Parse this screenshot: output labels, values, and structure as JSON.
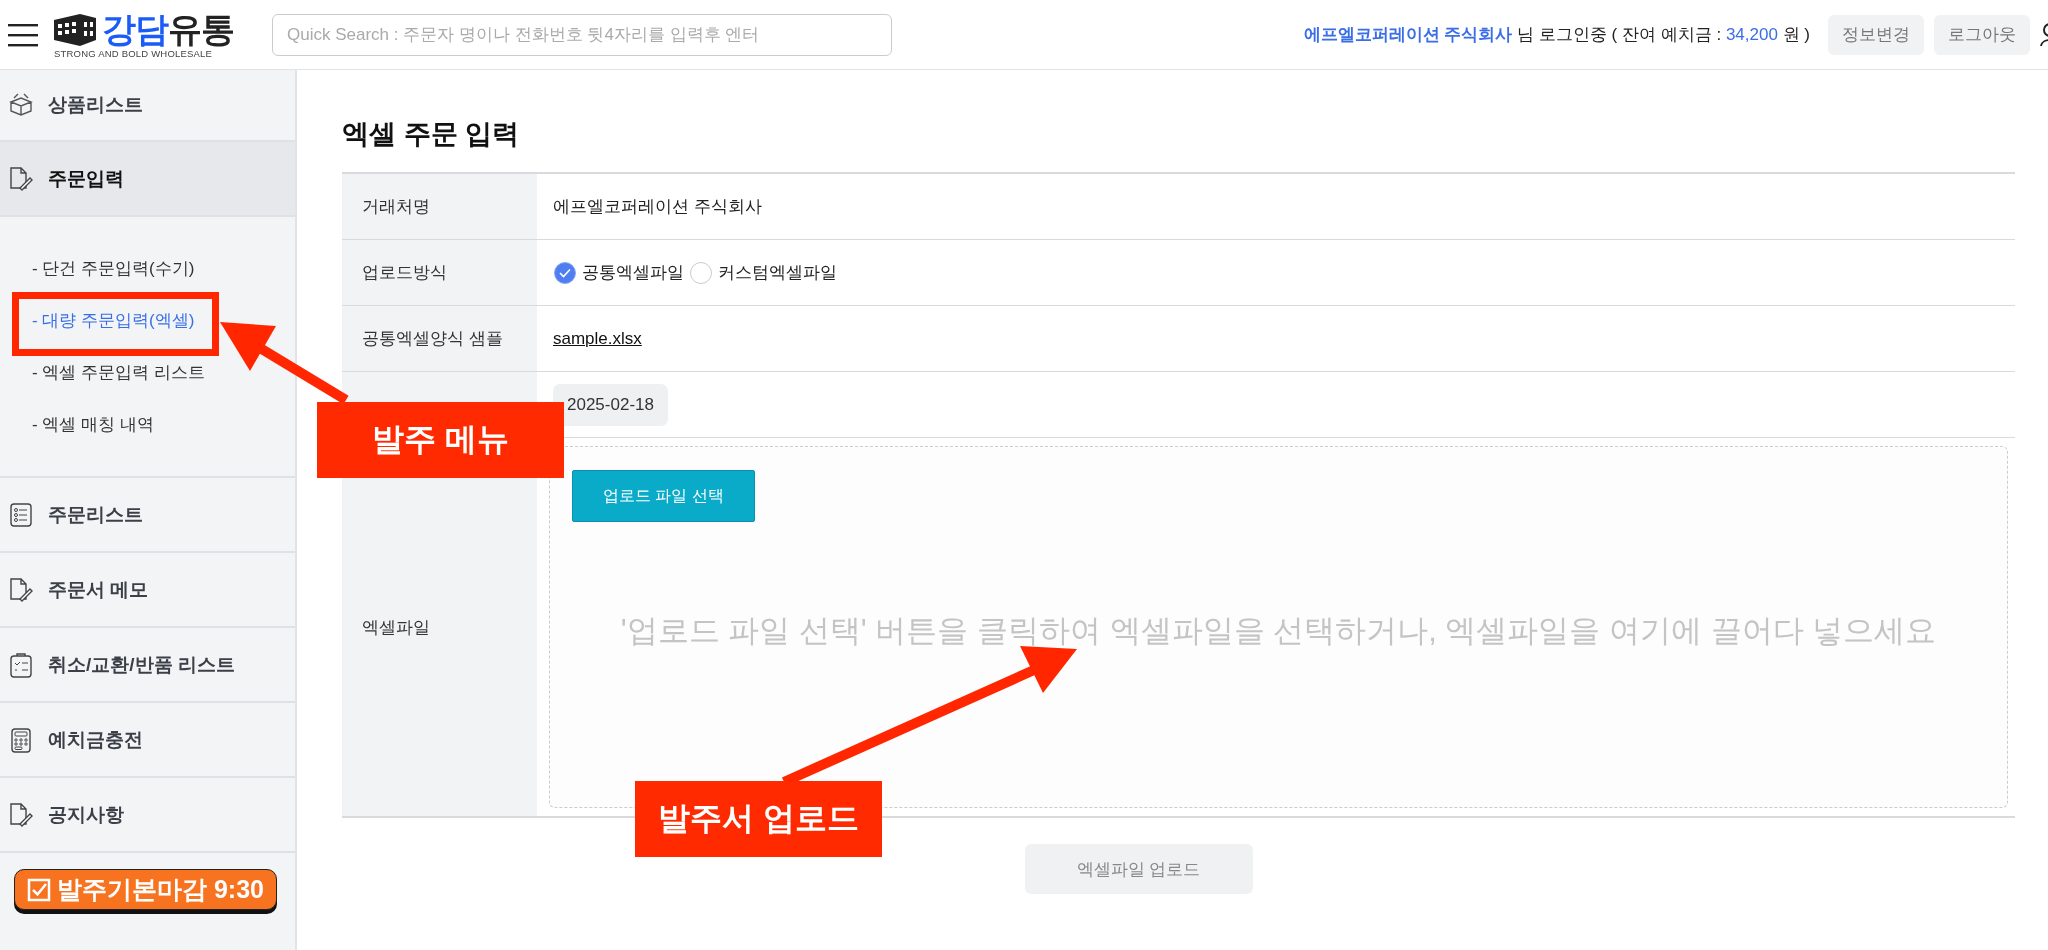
{
  "header": {
    "logo": {
      "accent": "강담",
      "rest": "유통",
      "tagline": "STRONG AND BOLD WHOLESALE"
    },
    "search": {
      "placeholder": "Quick Search : 주문자 명이나 전화번호 뒷4자리를 입력후 엔터"
    },
    "user_status": {
      "company": "에프엘코퍼레이션 주식회사",
      "text_before": "님 로그인중 ( 잔여 예치금 :",
      "balance": "34,200",
      "text_after": "원 )"
    },
    "buttons": [
      "정보변경",
      "로그아웃"
    ]
  },
  "sidebar": {
    "items": [
      {
        "label": "상품리스트",
        "selected": false
      },
      {
        "label": "주문입력",
        "selected": true,
        "children": [
          {
            "label": "- 단건 주문입력(수기)",
            "selected": false
          },
          {
            "label": "- 대량 주문입력(엑셀)",
            "selected": true
          },
          {
            "label": "- 엑셀 주문입력 리스트",
            "selected": false
          },
          {
            "label": "- 엑셀 매칭 내역",
            "selected": false
          }
        ]
      },
      {
        "label": "주문리스트",
        "selected": false
      },
      {
        "label": "주문서 메모",
        "selected": false
      },
      {
        "label": "취소/교환/반품 리스트",
        "selected": false
      },
      {
        "label": "예치금충전",
        "selected": false
      },
      {
        "label": "공지사항",
        "selected": false
      }
    ],
    "deadline_badge": "발주기본마감 9:30"
  },
  "page": {
    "title": "엑셀 주문 입력",
    "form": [
      {
        "kind": "text",
        "label": "거래처명",
        "value": "에프엘코퍼레이션 주식회사"
      },
      {
        "kind": "radio",
        "label": "업로드방식",
        "options": [
          {
            "label": "공통엑셀파일",
            "selected": true
          },
          {
            "label": "커스텀엑셀파일",
            "selected": false
          }
        ]
      },
      {
        "kind": "link",
        "label": "공통엑셀양식 샘플",
        "value": "sample.xlsx"
      },
      {
        "kind": "date",
        "value": "2025-02-18"
      },
      {
        "kind": "dropzone",
        "label": "엑셀파일",
        "button": "업로드 파일 선택",
        "hint": "'업로드 파일 선택' 버튼을 클릭하여 엑셀파일을 선택하거나, 엑셀파일을 여기에 끌어다 넣으세요"
      }
    ],
    "submit": "엑셀파일 업로드"
  },
  "callouts": [
    {
      "text": "발주 메뉴"
    },
    {
      "text": "발주서 업로드"
    }
  ]
}
